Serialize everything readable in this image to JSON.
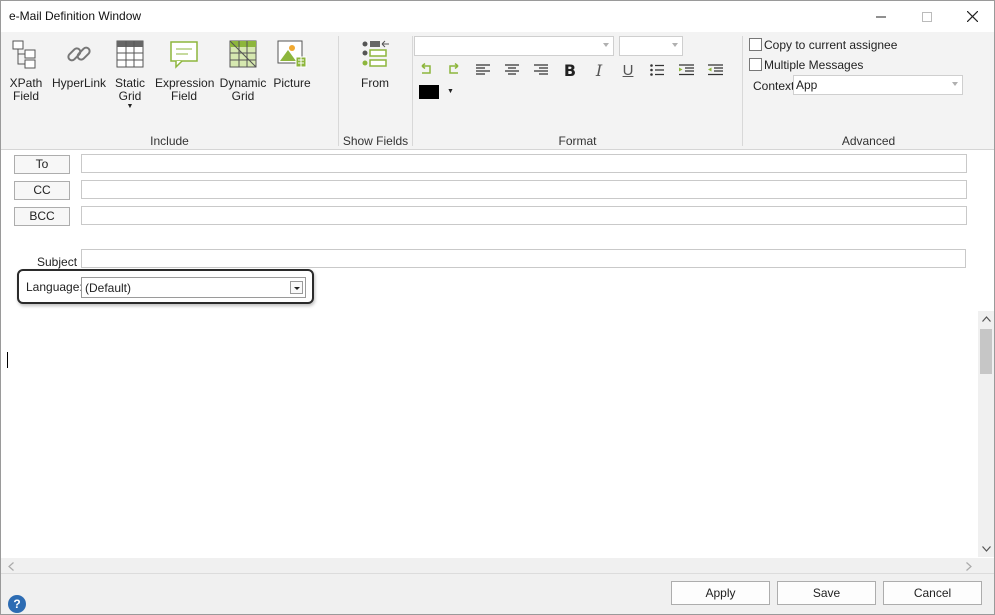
{
  "window": {
    "title": "e-Mail Definition Window",
    "minimize_icon": "minimize-icon",
    "maximize_icon": "maximize-icon",
    "close_icon": "close-icon"
  },
  "ribbon": {
    "include": {
      "label": "Include",
      "buttons": [
        {
          "label": "XPath\nField",
          "icon": "xpath-field-icon"
        },
        {
          "label": "HyperLink",
          "icon": "hyperlink-icon"
        },
        {
          "label": "Static\nGrid",
          "icon": "static-grid-icon"
        },
        {
          "label": "Expression\nField",
          "icon": "expression-field-icon"
        },
        {
          "label": "Dynamic\nGrid",
          "icon": "dynamic-grid-icon"
        },
        {
          "label": "Picture",
          "icon": "picture-icon"
        }
      ]
    },
    "show_fields": {
      "label": "Show Fields",
      "from_label": "From",
      "icon": "from-fields-icon"
    },
    "format": {
      "label": "Format",
      "font_name": "",
      "font_size": "",
      "text_color": "#000000"
    },
    "advanced": {
      "label": "Advanced",
      "copy_to_assignee_label": "Copy to current assignee",
      "copy_to_assignee_checked": false,
      "multiple_messages_label": "Multiple Messages",
      "multiple_messages_checked": false,
      "context_label": "Context",
      "context_value": "App"
    }
  },
  "form": {
    "to_label": "To",
    "cc_label": "CC",
    "bcc_label": "BCC",
    "to_value": "",
    "cc_value": "",
    "bcc_value": "",
    "subject_label": "Subject",
    "subject_value": "",
    "language_label": "Language:",
    "language_value": "(Default)"
  },
  "footer": {
    "apply_label": "Apply",
    "save_label": "Save",
    "cancel_label": "Cancel",
    "help_label": "?"
  },
  "colors": {
    "ribbon_bg": "#f3f3f3",
    "accent_green": "#8db63c",
    "accent_blue": "#2d6cb3"
  }
}
